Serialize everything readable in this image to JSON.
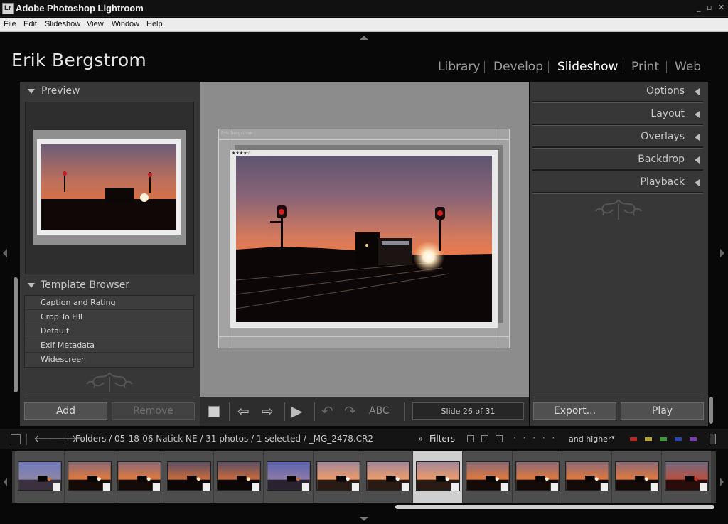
{
  "window": {
    "title": "Adobe Photoshop Lightroom",
    "icon": "Lr",
    "controls": [
      "_",
      "▫",
      "✕"
    ]
  },
  "menu": [
    "File",
    "Edit",
    "Slideshow",
    "View",
    "Window",
    "Help"
  ],
  "identity_plate": "Erik Bergstrom",
  "modules": [
    {
      "label": "Library",
      "active": false
    },
    {
      "label": "Develop",
      "active": false
    },
    {
      "label": "Slideshow",
      "active": true
    },
    {
      "label": "Print",
      "active": false
    },
    {
      "label": "Web",
      "active": false
    }
  ],
  "left_panel": {
    "preview_header": "Preview",
    "template_header": "Template Browser",
    "templates": [
      "Caption and Rating",
      "Crop To Fill",
      "Default",
      "Exif Metadata",
      "Widescreen"
    ],
    "add_label": "Add",
    "remove_label": "Remove"
  },
  "slide": {
    "identity_text": "Erik Bergstrom",
    "stars": "★★★★☆"
  },
  "toolbar": {
    "text_overlay_label": "ABC",
    "slide_counter": "Slide 26 of 31"
  },
  "right_panel": {
    "sections": [
      "Options",
      "Layout",
      "Overlays",
      "Backdrop",
      "Playback"
    ],
    "export_label": "Export...",
    "play_label": "Play"
  },
  "filmstrip": {
    "path": "Folders / 05-18-06 Natick NE / 31 photos / 1 selected / _MG_2478.CR2",
    "filters_label": "Filters",
    "filters_chevron": "»",
    "rating_dots": "· · · · ·",
    "rating_mode": "and higher",
    "color_labels": [
      "#b82626",
      "#b8a326",
      "#3a9a3a",
      "#2646b0",
      "#7a3ab0"
    ],
    "thumbnails": [
      {
        "kind": "train-day",
        "selected": false
      },
      {
        "kind": "sunset",
        "selected": false
      },
      {
        "kind": "sunset",
        "selected": false
      },
      {
        "kind": "sunset-dark",
        "selected": false
      },
      {
        "kind": "sunset-dark",
        "selected": false
      },
      {
        "kind": "train-dusk",
        "selected": false
      },
      {
        "kind": "sunset-light",
        "selected": false
      },
      {
        "kind": "sunset-light",
        "selected": false
      },
      {
        "kind": "sunset-light",
        "selected": true
      },
      {
        "kind": "sunset",
        "selected": false
      },
      {
        "kind": "sunset",
        "selected": false
      },
      {
        "kind": "sunset",
        "selected": false
      },
      {
        "kind": "sunset",
        "selected": false
      },
      {
        "kind": "train-red",
        "selected": false
      }
    ]
  }
}
